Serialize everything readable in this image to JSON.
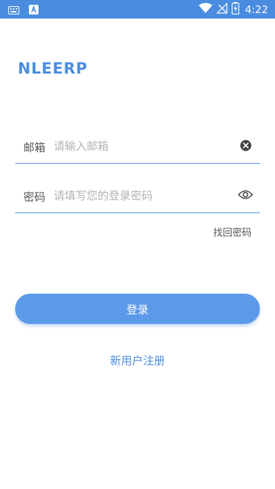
{
  "status_bar": {
    "time": "4:22",
    "icons_left": [
      "keyboard-icon",
      "text-a-icon"
    ],
    "icons_right": [
      "wifi-icon",
      "no-signal-icon",
      "battery-charging-icon"
    ]
  },
  "app": {
    "title": "NLEERP"
  },
  "form": {
    "email": {
      "label": "邮箱",
      "placeholder": "请输入邮箱",
      "value": "",
      "action_icon": "clear-icon"
    },
    "password": {
      "label": "密码",
      "placeholder": "请填写您的登录密码",
      "value": "",
      "action_icon": "eye-icon"
    },
    "forgot_label": "找回密码",
    "login_label": "登录",
    "register_label": "新用户注册"
  },
  "colors": {
    "accent": "#4a8de0",
    "button": "#5b9ae8",
    "background": "#ffffff"
  }
}
